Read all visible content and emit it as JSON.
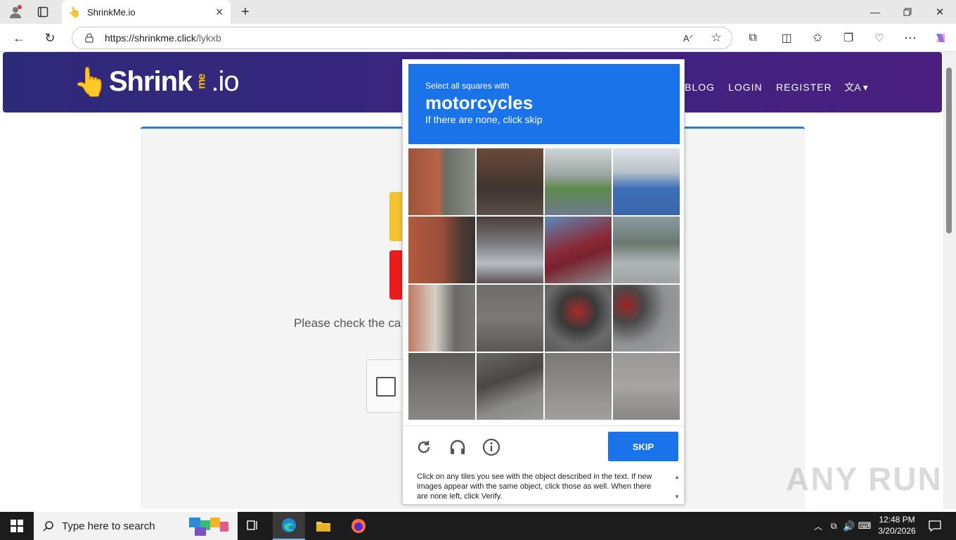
{
  "browser": {
    "tab_title": "ShrinkMe.io",
    "url_host": "https://shrinkme.click",
    "url_path": "/lykxb"
  },
  "site": {
    "logo_main": "Shrink",
    "logo_me": "me",
    "logo_io": ".io",
    "nav": [
      "BLOG",
      "LOGIN",
      "REGISTER"
    ],
    "check_text": "Please check the ca"
  },
  "captcha": {
    "instruction_small": "Select all squares with",
    "target": "motorcycles",
    "instruction_sub": "If there are none, click skip",
    "skip_label": "SKIP",
    "help_text": "Click on any tiles you see with the object described in the text. If new images appear with the same object, click those as well. When there are none left, click Verify."
  },
  "taskbar": {
    "search_placeholder": "Type here to search",
    "time": "12:48 PM",
    "date": "3/20/2026"
  },
  "watermark": "ANY RUN",
  "colors": {
    "header_start": "#2e2a7a",
    "header_end": "#4a1f80",
    "captcha_blue": "#1a73e8",
    "card_top_border": "#2b7bd9"
  }
}
